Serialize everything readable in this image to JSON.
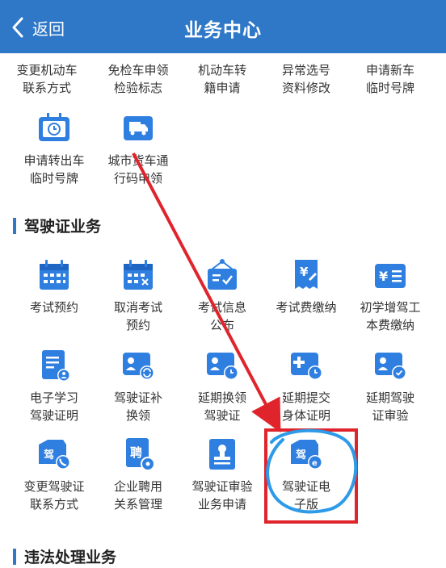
{
  "header": {
    "back_label": "返回",
    "title": "业务中心"
  },
  "vehicle_items_row1": [
    {
      "line1": "变更机动车",
      "line2": "联系方式"
    },
    {
      "line1": "免检车申领",
      "line2": "检验标志"
    },
    {
      "line1": "机动车转",
      "line2": "籍申请"
    },
    {
      "line1": "异常选号",
      "line2": "资料修改"
    },
    {
      "line1": "申请新车",
      "line2": "临时号牌"
    }
  ],
  "vehicle_items_row2": [
    {
      "line1": "申请转出车",
      "line2": "临时号牌",
      "icon": "clock-plate-icon"
    },
    {
      "line1": "城市货车通",
      "line2": "行码申领",
      "icon": "truck-icon"
    }
  ],
  "license_section": {
    "title": "驾驶证业务",
    "items": [
      {
        "line1": "考试预约",
        "line2": "",
        "icon": "calendar-icon"
      },
      {
        "line1": "取消考试",
        "line2": "预约",
        "icon": "calendar-cancel-icon"
      },
      {
        "line1": "考试信息",
        "line2": "公布",
        "icon": "notice-board-icon"
      },
      {
        "line1": "考试费缴纳",
        "line2": "",
        "icon": "fee-receipt-icon"
      },
      {
        "line1": "初学增驾工",
        "line2": "本费缴纳",
        "icon": "yen-list-icon"
      },
      {
        "line1": "电子学习",
        "line2": "驾驶证明",
        "icon": "study-document-icon"
      },
      {
        "line1": "驾驶证补",
        "line2": "换领",
        "icon": "license-refresh-icon"
      },
      {
        "line1": "延期换领",
        "line2": "驾驶证",
        "icon": "license-clock-icon"
      },
      {
        "line1": "延期提交",
        "line2": "身体证明",
        "icon": "medical-clock-icon"
      },
      {
        "line1": "延期驾驶",
        "line2": "证审验",
        "icon": "license-check-icon"
      },
      {
        "line1": "变更驾驶证",
        "line2": "联系方式",
        "icon": "license-phone-icon"
      },
      {
        "line1": "企业聘用",
        "line2": "关系管理",
        "icon": "employment-gear-icon"
      },
      {
        "line1": "驾驶证审验",
        "line2": "业务申请",
        "icon": "stamp-document-icon"
      },
      {
        "line1": "驾驶证电",
        "line2": "子版",
        "icon": "electronic-license-icon"
      }
    ]
  },
  "violation_section": {
    "title": "违法处理业务"
  },
  "colors": {
    "header": "#2f78c8",
    "icon_blue": "#2f7fe0",
    "highlight_red": "#e0242c",
    "circle_blue": "#2e9be8"
  }
}
